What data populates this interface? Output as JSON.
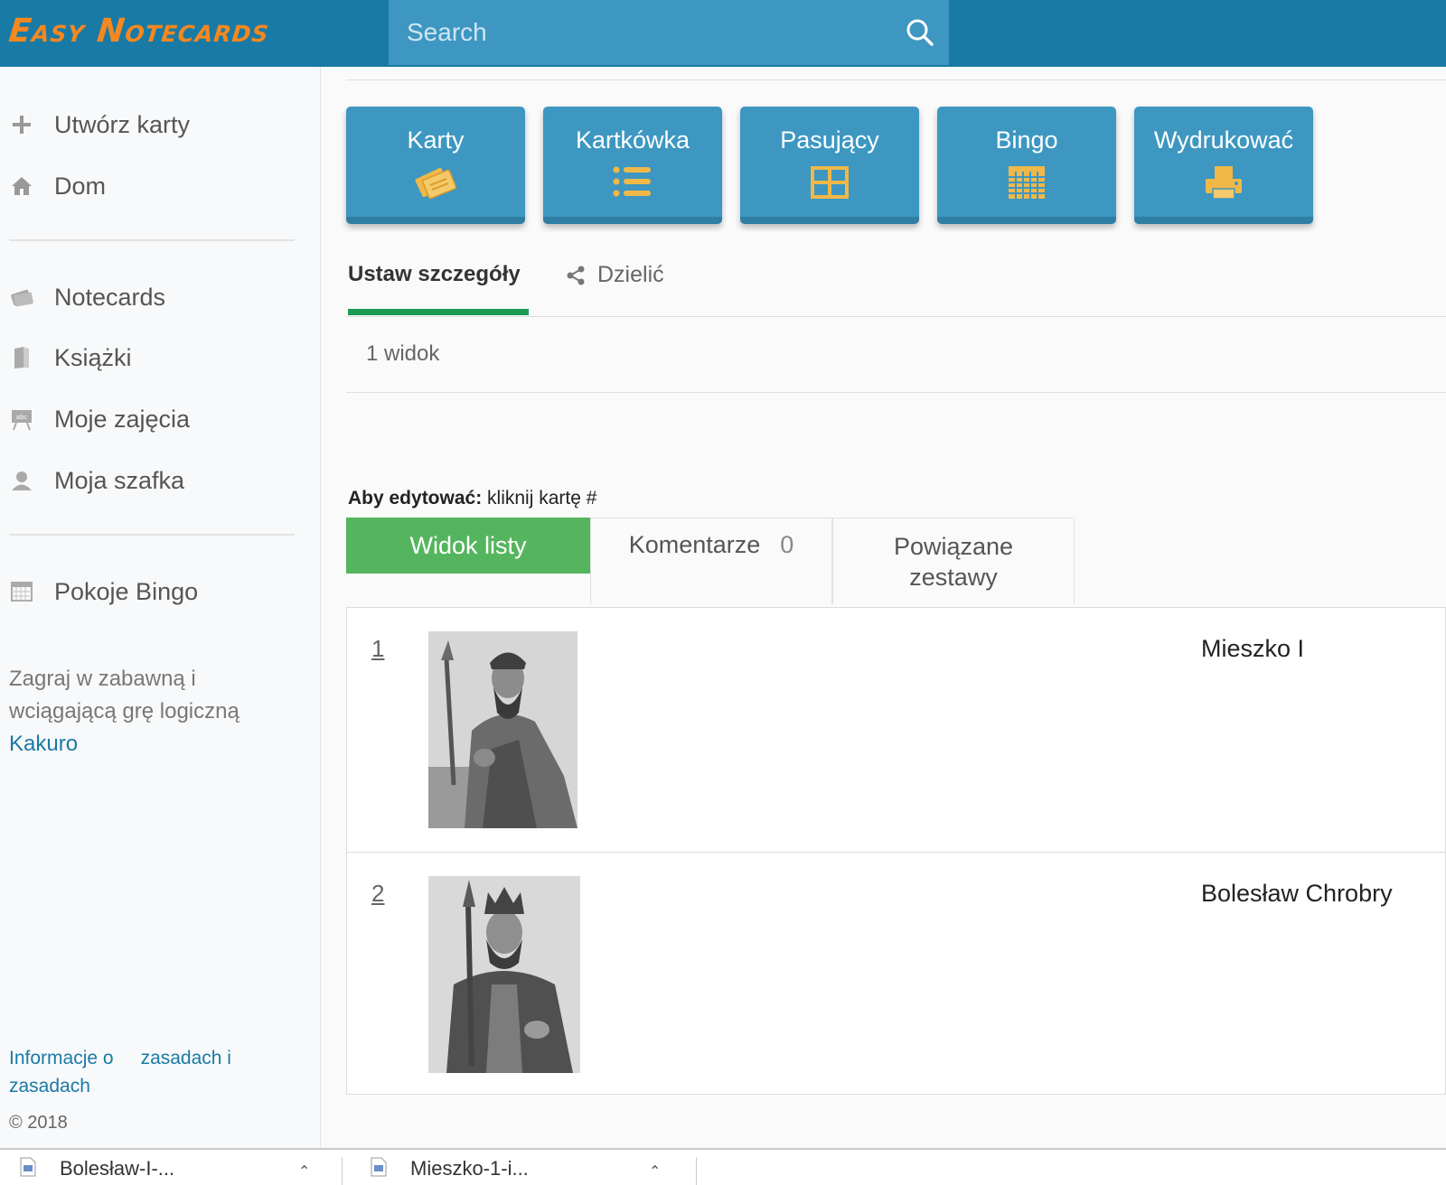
{
  "header": {
    "logo": "Easy Notecards",
    "search_placeholder": "Search"
  },
  "sidebar": {
    "top_items": [
      {
        "label": "Utwórz karty",
        "icon": "plus-icon"
      },
      {
        "label": "Dom",
        "icon": "home-icon"
      }
    ],
    "main_items": [
      {
        "label": "Notecards",
        "icon": "notecards-icon"
      },
      {
        "label": "Książki",
        "icon": "book-icon"
      },
      {
        "label": "Moje zajęcia",
        "icon": "classroom-icon"
      },
      {
        "label": "Moja szafka",
        "icon": "user-icon"
      }
    ],
    "bingo_item": {
      "label": "Pokoje Bingo",
      "icon": "calendar-grid-icon"
    },
    "promo_text": "Zagraj w zabawną i wciągającą grę logiczną",
    "promo_link": "Kakuro",
    "footer_link_1": "Informacje o",
    "footer_link_2": "zasadach i",
    "footer_link_3": "zasadach",
    "copyright": "© 2018"
  },
  "modes": [
    {
      "label": "Karty",
      "icon": "cards-icon"
    },
    {
      "label": "Kartkówka",
      "icon": "list-icon"
    },
    {
      "label": "Pasujący",
      "icon": "match-grid-icon"
    },
    {
      "label": "Bingo",
      "icon": "bingo-grid-icon"
    },
    {
      "label": "Wydrukować",
      "icon": "printer-icon"
    }
  ],
  "tabs": {
    "details": "Ustaw szczegóły",
    "share": "Dzielić"
  },
  "views_text": "1 widok",
  "edit_hint": {
    "bold": "Aby edytować:",
    "text": " kliknij kartę #"
  },
  "sub_tabs": {
    "list_view": "Widok listy",
    "comments": "Komentarze",
    "comments_count": "0",
    "related": "Powiązane zestawy"
  },
  "cards": [
    {
      "number": "1",
      "answer": "Mieszko I"
    },
    {
      "number": "2",
      "answer": "Bolesław Chrobry"
    }
  ],
  "downloads": [
    {
      "label": "Bolesław-I-..."
    },
    {
      "label": "Mieszko-1-i..."
    }
  ],
  "colors": {
    "header": "#1a7aa6",
    "logo": "#f5881f",
    "mode_button": "#3d97c1",
    "mode_icon": "#f0b849",
    "active_tab_green": "#55b55f",
    "underline_green": "#1a9a56",
    "link": "#1a7aa6"
  }
}
